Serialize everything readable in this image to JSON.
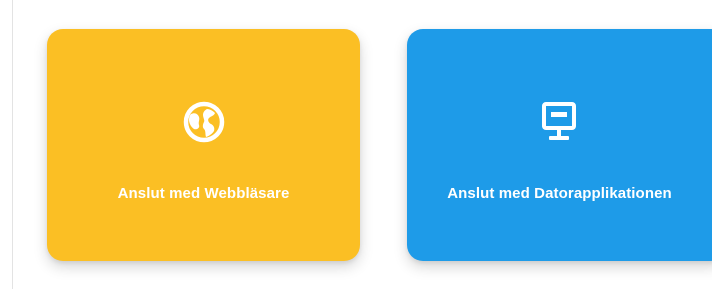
{
  "cards": [
    {
      "label": "Anslut med Webbläsare",
      "icon": "globe-icon",
      "color": "#FBBF24"
    },
    {
      "label": "Anslut med Datorapplikationen",
      "icon": "monitor-icon",
      "color": "#1E9BE8"
    }
  ]
}
